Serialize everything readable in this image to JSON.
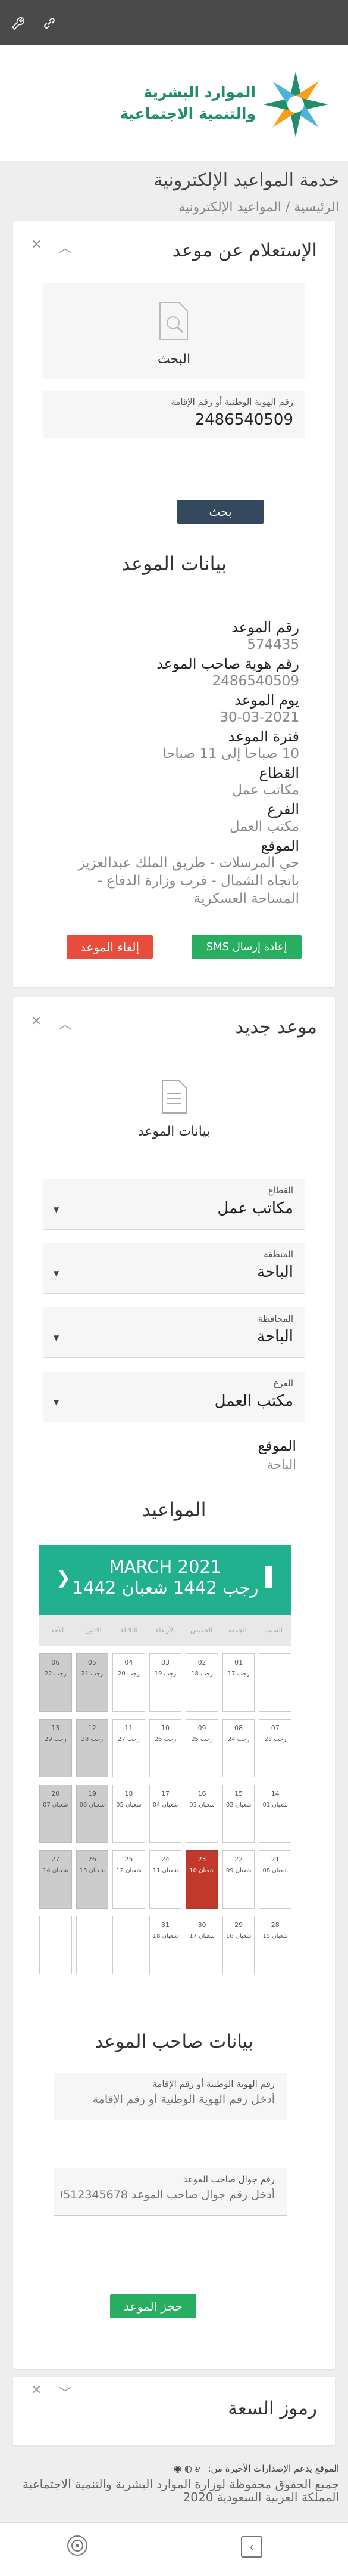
{
  "top_bar": {
    "icons": [
      "wrench-icon",
      "link-icon"
    ]
  },
  "header": {
    "org_name_line1": "الموارد البشرية",
    "org_name_line2": "والتنمية الاجتماعية"
  },
  "page": {
    "title": "خدمة المواعيد الإلكترونية",
    "breadcrumb": "الرئيسية / المواعيد الإلكترونية"
  },
  "inquiry": {
    "title": "الإستعلام عن موعد",
    "search_label": "البحث",
    "id_field_label": "رقم الهوية الوطنية أو رقم الإقامة",
    "id_field_value": "2486540509",
    "search_button": "بحث",
    "details_title": "بيانات الموعد",
    "details": [
      {
        "label": "رقم الموعد",
        "value": "574435"
      },
      {
        "label": "رقم هوية صاحب الموعد",
        "value": "2486540509"
      },
      {
        "label": "يوم الموعد",
        "value": "30-03-2021"
      },
      {
        "label": "فترة الموعد",
        "value": "10 صباحا إلى 11 صباحا"
      },
      {
        "label": "القطاع",
        "value": "مكاتب عمل"
      },
      {
        "label": "الفرع",
        "value": "مكتب العمل"
      },
      {
        "label": "الموقع",
        "value": "حي المرسلات - طريق الملك عبدالعزيز باتجاه الشمال - قرب وزارة الدفاع - المساحة العسكرية"
      }
    ],
    "resend_sms_button": "إعادة إرسال SMS",
    "cancel_button": "إلغاء الموعد",
    "colors": {
      "primary": "#2c3e50",
      "success": "#27ae60",
      "danger": "#e74c3c"
    }
  },
  "new_appointment": {
    "title": "موعد جديد",
    "data_label": "بيانات الموعد",
    "sector_label": "القطاع",
    "sector_value": "مكاتب عمل",
    "region_label": "المنطقة",
    "region_value": "الباحة",
    "governorate_label": "المحافظة",
    "governorate_value": "الباحة",
    "branch_label": "الفرع",
    "branch_value": "مكتب العمل",
    "location_label": "الموقع",
    "location_value": "الباحة",
    "slots_title": "المواعيد",
    "calendar": {
      "gregorian_month": "MARCH 2021",
      "hijri_month": "رجب 1442 شعبان 1442",
      "day_names": [
        "الأحد",
        "الاثنين",
        "الثلاثاء",
        "الأربعاء",
        "الخميس",
        "الجمعة",
        "السبت"
      ],
      "weeks": [
        [
          {
            "g": "",
            "h": "",
            "s": "empty"
          },
          {
            "g": "01",
            "h": "17 رجب",
            "s": "normal"
          },
          {
            "g": "02",
            "h": "18 رجب",
            "s": "normal"
          },
          {
            "g": "03",
            "h": "19 رجب",
            "s": "normal"
          },
          {
            "g": "04",
            "h": "20 رجب",
            "s": "normal"
          },
          {
            "g": "05",
            "h": "21 رجب",
            "s": "off"
          },
          {
            "g": "06",
            "h": "22 رجب",
            "s": "off"
          }
        ],
        [
          {
            "g": "07",
            "h": "23 رجب",
            "s": "normal"
          },
          {
            "g": "08",
            "h": "24 رجب",
            "s": "normal"
          },
          {
            "g": "09",
            "h": "25 رجب",
            "s": "normal"
          },
          {
            "g": "10",
            "h": "26 رجب",
            "s": "normal"
          },
          {
            "g": "11",
            "h": "27 رجب",
            "s": "normal"
          },
          {
            "g": "12",
            "h": "28 رجب",
            "s": "off"
          },
          {
            "g": "13",
            "h": "29 رجب",
            "s": "off"
          }
        ],
        [
          {
            "g": "14",
            "h": "01 شعبان",
            "s": "normal"
          },
          {
            "g": "15",
            "h": "02 شعبان",
            "s": "normal"
          },
          {
            "g": "16",
            "h": "03 شعبان",
            "s": "normal"
          },
          {
            "g": "17",
            "h": "04 شعبان",
            "s": "normal"
          },
          {
            "g": "18",
            "h": "05 شعبان",
            "s": "normal"
          },
          {
            "g": "19",
            "h": "06 شعبان",
            "s": "off"
          },
          {
            "g": "20",
            "h": "07 شعبان",
            "s": "off"
          }
        ],
        [
          {
            "g": "21",
            "h": "08 شعبان",
            "s": "normal"
          },
          {
            "g": "22",
            "h": "09 شعبان",
            "s": "normal"
          },
          {
            "g": "23",
            "h": "10 شعبان",
            "s": "today"
          },
          {
            "g": "24",
            "h": "11 شعبان",
            "s": "normal"
          },
          {
            "g": "25",
            "h": "12 شعبان",
            "s": "normal"
          },
          {
            "g": "26",
            "h": "13 شعبان",
            "s": "off"
          },
          {
            "g": "27",
            "h": "14 شعبان",
            "s": "off"
          }
        ],
        [
          {
            "g": "28",
            "h": "15 شعبان",
            "s": "normal"
          },
          {
            "g": "29",
            "h": "16 شعبان",
            "s": "normal"
          },
          {
            "g": "30",
            "h": "17 شعبان",
            "s": "normal"
          },
          {
            "g": "31",
            "h": "18 شعبان",
            "s": "normal"
          },
          {
            "g": "",
            "h": "",
            "s": "empty"
          },
          {
            "g": "",
            "h": "",
            "s": "empty"
          },
          {
            "g": "",
            "h": "",
            "s": "empty"
          }
        ]
      ]
    },
    "owner_title": "بيانات صاحب الموعد",
    "owner_id_label": "رقم الهوية الوطنية أو رقم الإقامة",
    "owner_id_placeholder": "أدخل رقم الهوية الوطنية أو رقم الإقامة",
    "owner_phone_label": "رقم جوال صاحب الموعد",
    "owner_phone_placeholder": "أدخل رقم جوال صاحب الموعد 0512345678",
    "book_button": "حجز الموعد"
  },
  "captcha": {
    "title": "رموز السعة"
  },
  "footer": {
    "browser_note": "الموقع يدعم الإصدارات الأخيرة من:",
    "copyright": "جميع الحقوق محفوظة لوزارة الموارد البشرية والتنمية الاجتماعية المملكة العربية السعودية 2020"
  }
}
